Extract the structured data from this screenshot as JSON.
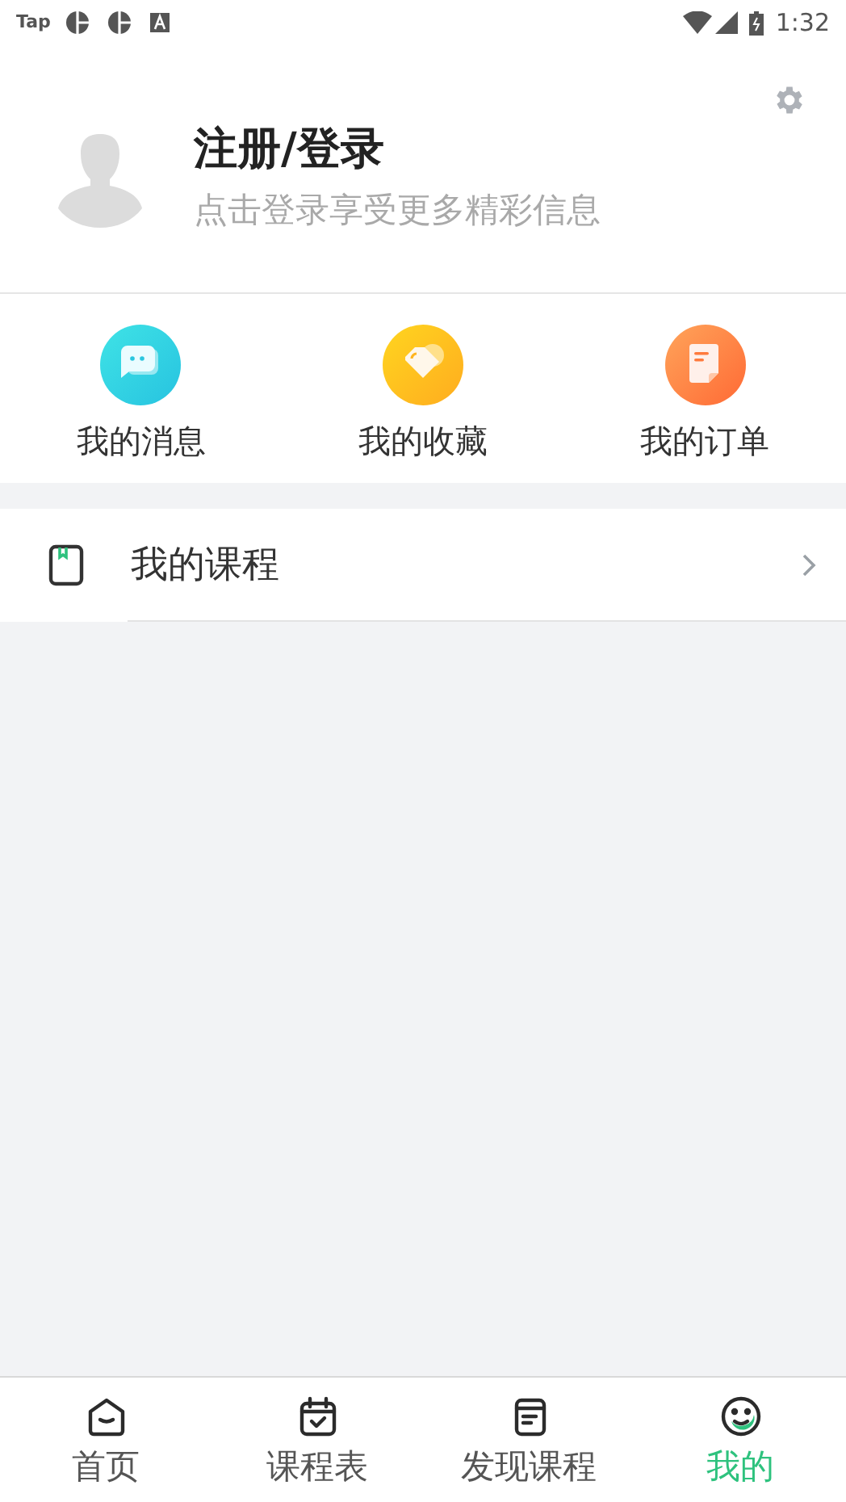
{
  "status_bar": {
    "app_label": "Tap",
    "time": "1:32"
  },
  "profile": {
    "title": "注册/登录",
    "subtitle": "点击登录享受更多精彩信息"
  },
  "shortcuts": [
    {
      "kind": "message",
      "label": "我的消息"
    },
    {
      "kind": "favorite",
      "label": "我的收藏"
    },
    {
      "kind": "order",
      "label": "我的订单"
    }
  ],
  "menu": [
    {
      "label": "我的课程"
    }
  ],
  "tabs": [
    {
      "kind": "home",
      "label": "首页",
      "selected": false
    },
    {
      "kind": "calendar",
      "label": "课程表",
      "selected": false
    },
    {
      "kind": "discover",
      "label": "发现课程",
      "selected": false
    },
    {
      "kind": "me",
      "label": "我的",
      "selected": true
    }
  ]
}
